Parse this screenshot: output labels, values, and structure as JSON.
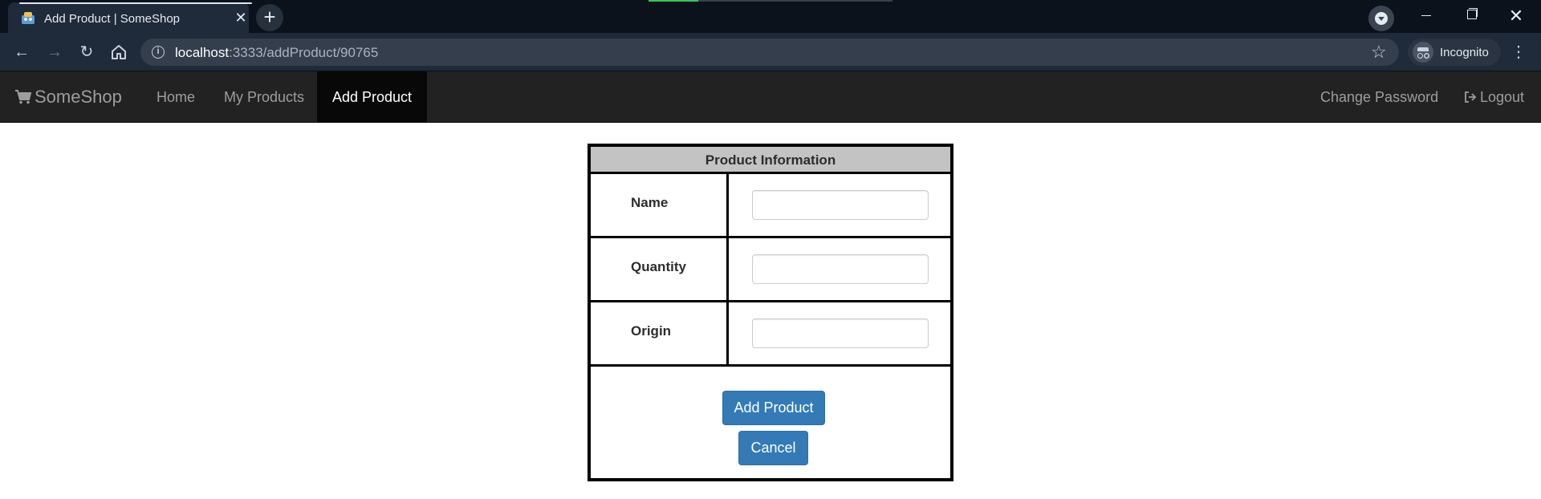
{
  "browser": {
    "tab_title": "Add Product | SomeShop",
    "tab_close": "✕",
    "new_tab": "+",
    "url_host": "localhost",
    "url_path": ":3333/addProduct/90765",
    "profile_label": "Incognito",
    "icons": [
      "back-icon",
      "forward-icon",
      "reload-icon",
      "home-icon",
      "info-icon",
      "star-icon",
      "incognito-icon",
      "menu-icon"
    ]
  },
  "navbar": {
    "brand": "SomeShop",
    "brand_icon": "shopping-cart-icon",
    "links": {
      "home": "Home",
      "my_products": "My Products",
      "add_product": "Add Product",
      "change_password": "Change Password",
      "logout": "Logout"
    },
    "logout_icon": "logout-icon",
    "background_color": "#222222",
    "active_color": "#080808"
  },
  "form": {
    "header": "Product Information",
    "fields": {
      "name": {
        "label": "Name",
        "value": ""
      },
      "quantity": {
        "label": "Quantity",
        "value": ""
      },
      "origin": {
        "label": "Origin",
        "value": ""
      }
    },
    "submit_label": "Add Product",
    "cancel_label": "Cancel",
    "button_color": "#337ab7"
  }
}
